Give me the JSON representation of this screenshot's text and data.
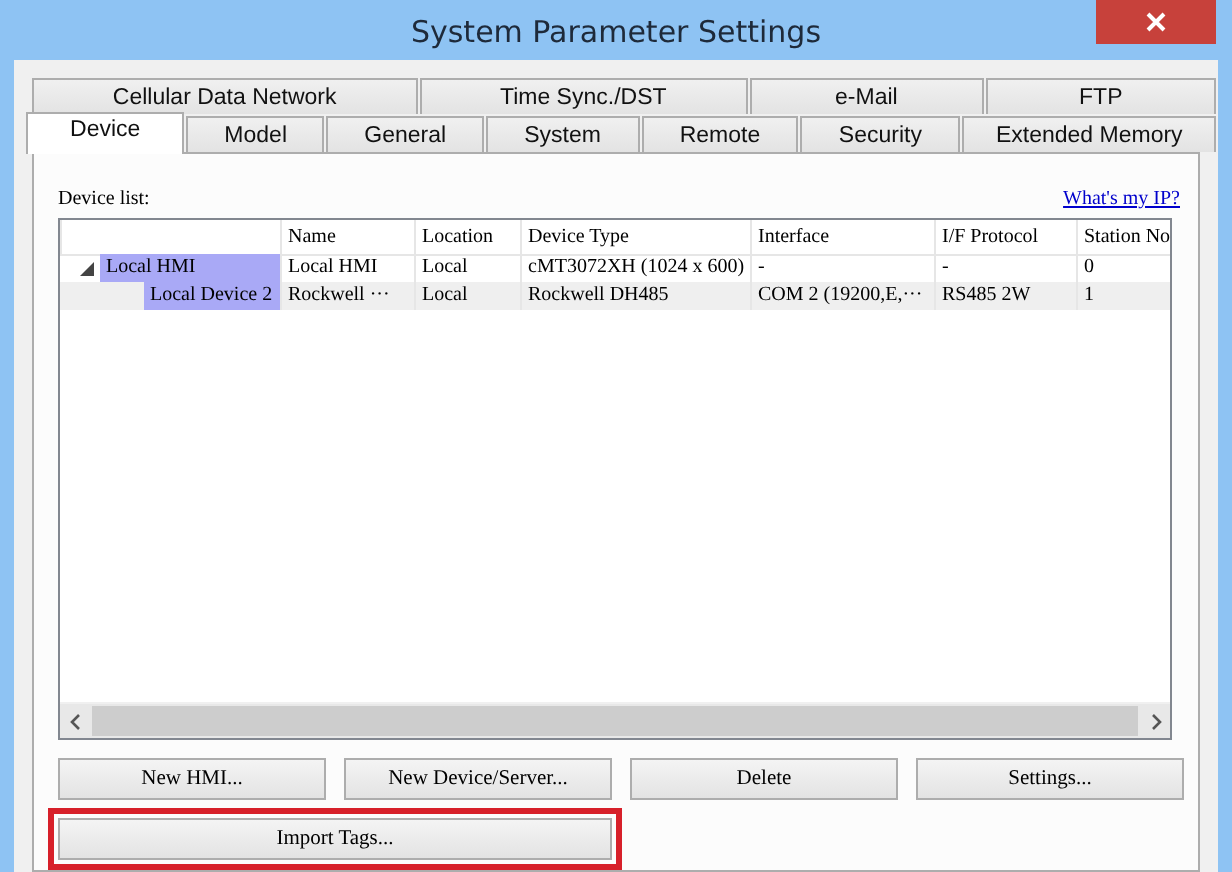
{
  "window": {
    "title": "System Parameter Settings"
  },
  "tab_rows": [
    [
      {
        "label": "Cellular Data Network",
        "selected": false
      },
      {
        "label": "Time Sync./DST",
        "selected": false
      },
      {
        "label": "e-Mail",
        "selected": false
      },
      {
        "label": "FTP",
        "selected": false
      }
    ],
    [
      {
        "label": "Device",
        "selected": true
      },
      {
        "label": "Model",
        "selected": false
      },
      {
        "label": "General",
        "selected": false
      },
      {
        "label": "System",
        "selected": false
      },
      {
        "label": "Remote",
        "selected": false
      },
      {
        "label": "Security",
        "selected": false
      },
      {
        "label": "Extended Memory",
        "selected": false
      }
    ]
  ],
  "device_list": {
    "label": "Device list:",
    "link": "What's my IP?",
    "columns": [
      "Name",
      "Location",
      "Device Type",
      "Interface",
      "I/F Protocol",
      "Station No"
    ],
    "rows": [
      {
        "label": "Local HMI",
        "expanded": true,
        "selected": false,
        "cells": [
          "Local HMI",
          "Local",
          "cMT3072XH (1024 x 600)",
          "-",
          "-",
          "0"
        ],
        "children": [
          {
            "label": "Local Device 2",
            "selected": true,
            "cells": [
              "Rockwell ···",
              "Local",
              "Rockwell DH485",
              "COM 2 (19200,E,···",
              "RS485 2W",
              "1"
            ]
          }
        ]
      }
    ]
  },
  "buttons": [
    {
      "label": "New HMI...",
      "highlighted": false
    },
    {
      "label": "New Device/Server...",
      "highlighted": false
    },
    {
      "label": "Delete",
      "highlighted": false
    },
    {
      "label": "Settings...",
      "highlighted": false
    },
    {
      "label": "Import Tags...",
      "highlighted": true
    }
  ]
}
